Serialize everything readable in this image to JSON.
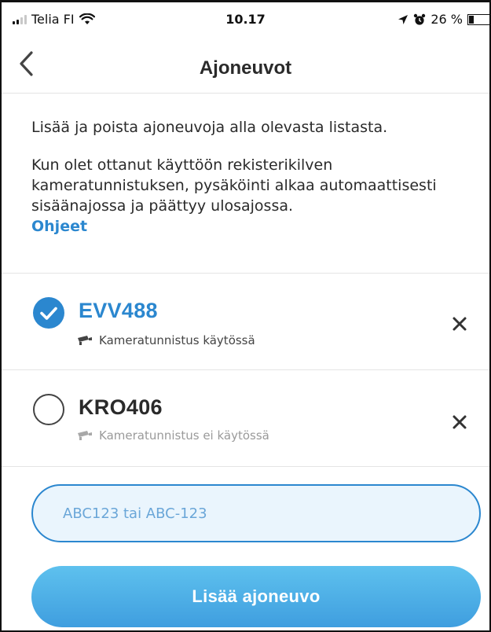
{
  "status_bar": {
    "carrier": "Telia FI",
    "time": "10.17",
    "battery": "26 %",
    "battery_level": 0.26
  },
  "nav": {
    "title": "Ajoneuvot",
    "back_icon": "chevron-left-icon"
  },
  "intro": {
    "paragraph1": "Lisää ja poista ajoneuvoja alla olevasta listasta.",
    "paragraph2": "Kun olet ottanut käyttöön rekisterikilven kameratunnistuksen, pysäköinti alkaa automaattisesti sisäänajossa ja päättyy ulosajossa.",
    "help_link": "Ohjeet"
  },
  "vehicles": [
    {
      "plate": "EVV488",
      "selected": true,
      "camera_status": "Kameratunnistus käytössä"
    },
    {
      "plate": "KRO406",
      "selected": false,
      "camera_status": "Kameratunnistus ei käytössä"
    }
  ],
  "add_form": {
    "placeholder": "ABC123 tai ABC-123",
    "value": "",
    "button_label": "Lisää ajoneuvo"
  },
  "colors": {
    "accent": "#2b87cf",
    "button_gradient_top": "#5ec1ee",
    "button_gradient_bottom": "#3f9edf",
    "input_bg": "#eaf5fd"
  }
}
